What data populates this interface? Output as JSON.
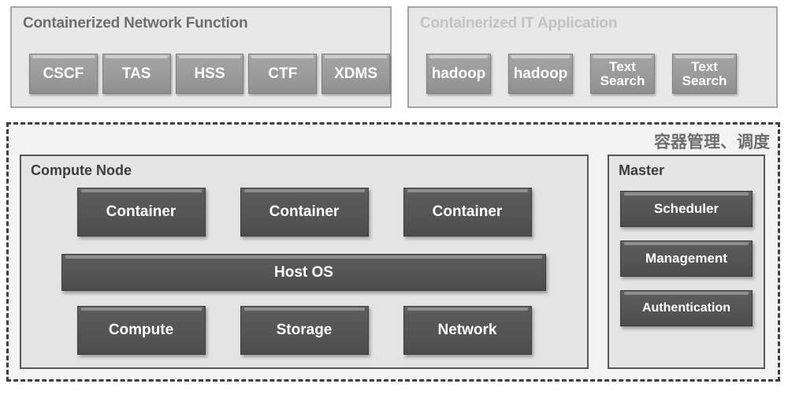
{
  "diagram": {
    "top_panels": [
      {
        "id": "containerized-network-function",
        "title": "Containerized Network Function",
        "title_color": "#6e6e6e",
        "items": [
          {
            "label": "CSCF"
          },
          {
            "label": "TAS"
          },
          {
            "label": "HSS"
          },
          {
            "label": "CTF"
          },
          {
            "label": "XDMS"
          }
        ]
      },
      {
        "id": "containerized-it-application",
        "title": "Containerized IT Application",
        "title_color": "#c2c2c2",
        "items": [
          {
            "label": "hadoop"
          },
          {
            "label": "hadoop"
          },
          {
            "label": "Text\nSearch",
            "line1": "Text",
            "line2": "Search"
          },
          {
            "label": "Text\nSearch",
            "line1": "Text",
            "line2": "Search"
          }
        ]
      }
    ],
    "platform": {
      "label": "容器管理、调度",
      "compute_node": {
        "title": "Compute Node",
        "containers": [
          {
            "label": "Container"
          },
          {
            "label": "Container"
          },
          {
            "label": "Container"
          }
        ],
        "host_os": {
          "label": "Host OS"
        },
        "resources": [
          {
            "label": "Compute"
          },
          {
            "label": "Storage"
          },
          {
            "label": "Network"
          }
        ]
      },
      "master": {
        "title": "Master",
        "services": [
          {
            "label": "Scheduler"
          },
          {
            "label": "Management"
          },
          {
            "label": "Authentication"
          }
        ]
      }
    },
    "colors": {
      "panel_background": "#e8e8e8",
      "panel_border": "#a6a6a6",
      "inner_panel_background": "#e4e4e4",
      "inner_panel_border": "#585858",
      "platform_background": "#f3f3f3",
      "platform_border": "#3f3f3f",
      "button_light": "#9b9b9b",
      "button_dark": "#545454",
      "button_text": "#ffffff"
    }
  }
}
